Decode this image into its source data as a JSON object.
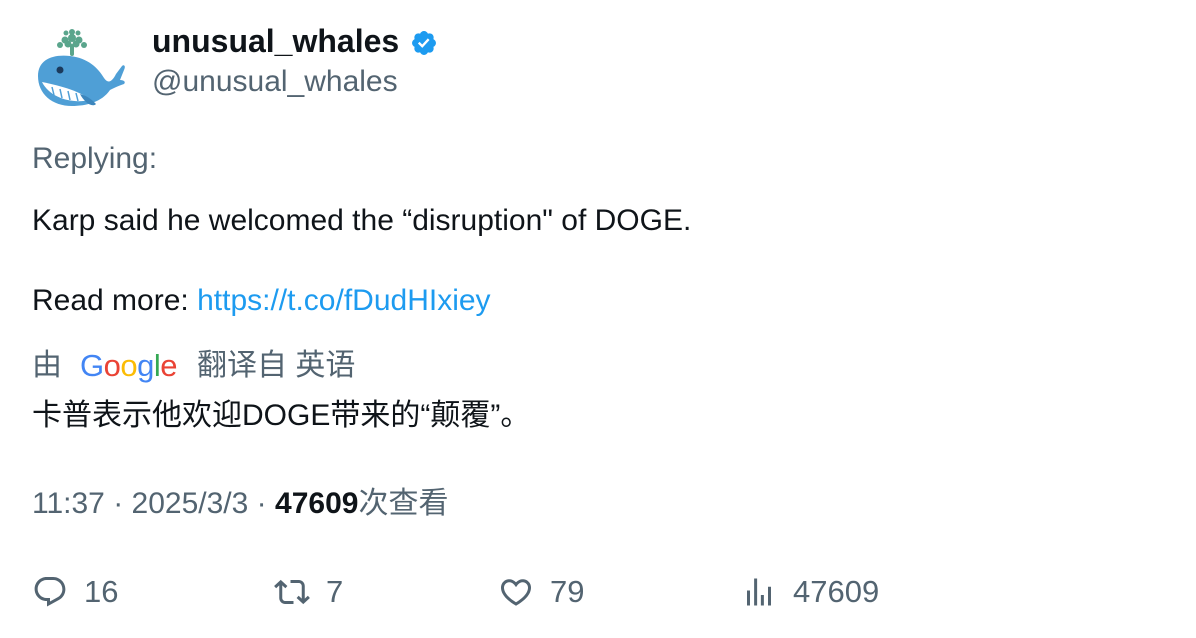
{
  "user": {
    "display_name": "unusual_whales",
    "handle": "@unusual_whales",
    "verified_color": "#1d9bf0"
  },
  "post": {
    "replying_label": "Replying:",
    "line1": "Karp said he welcomed the “disruption\" of DOGE.",
    "read_more_label": "Read more:",
    "link_text": "https://t.co/fDudHIxiey"
  },
  "translation": {
    "prefix": "由",
    "provider_letters": [
      "G",
      "o",
      "o",
      "g",
      "l",
      "e"
    ],
    "provider_colors": [
      "#4285F4",
      "#EA4335",
      "#FBBC05",
      "#4285F4",
      "#34A853",
      "#EA4335"
    ],
    "suffix": "翻译自 英语",
    "text": "卡普表示他欢迎DOGE带来的“颠覆”。"
  },
  "meta": {
    "time": "11:37",
    "separator": "·",
    "date": "2025/3/3",
    "views_count": "47609",
    "views_label": "次查看"
  },
  "actions": {
    "replies": "16",
    "retweets": "7",
    "likes": "79",
    "views": "47609"
  },
  "icons": [
    "whale-avatar-icon",
    "verified-badge-icon",
    "reply-icon",
    "retweet-icon",
    "like-icon",
    "views-icon"
  ]
}
